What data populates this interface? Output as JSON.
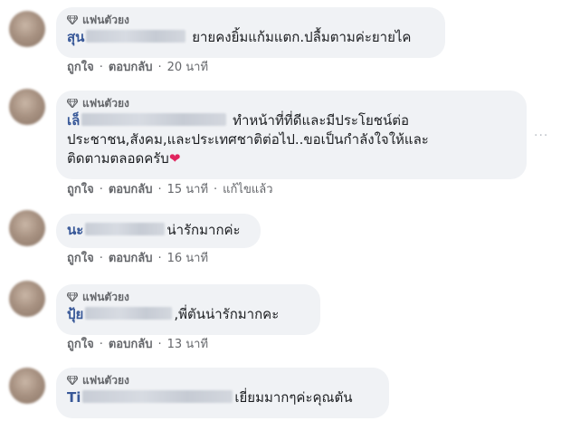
{
  "badge_label": "แฟนตัวยง",
  "comments": [
    {
      "name_prefix": "สุน",
      "text": "ยายคงยิ้มแก้มแตก.ปลื้มตามค่ะยายไค",
      "like": "ถูกใจ",
      "reply": "ตอบกลับ",
      "time": "20 นาที"
    },
    {
      "name_prefix": "เล็",
      "text_line1": "ทำหน้าที่ที่ดีและมีประโยชน์ต่อ",
      "text_line2": "ประชาชน,สังคม,และประเทศชาติต่อไป..ขอเป็นกำลังใจให้และ",
      "text_line3": "ติดตามตลอดครับ",
      "heart": "❤",
      "like": "ถูกใจ",
      "reply": "ตอบกลับ",
      "time": "15 นาที",
      "edited": "แก้ไขแล้ว",
      "more": "···"
    },
    {
      "name_prefix": "นะ",
      "text": "น่ารักมากค่ะ",
      "like": "ถูกใจ",
      "reply": "ตอบกลับ",
      "time": "16 นาที"
    },
    {
      "name_prefix": "ปุ้ย",
      "text": ",พี่ตันน่ารักมากคะ",
      "like": "ถูกใจ",
      "reply": "ตอบกลับ",
      "time": "13 นาที"
    },
    {
      "name_prefix": "Ti",
      "text": "เยี่ยมมากๆค่ะคุณตัน"
    }
  ],
  "dot": "·"
}
